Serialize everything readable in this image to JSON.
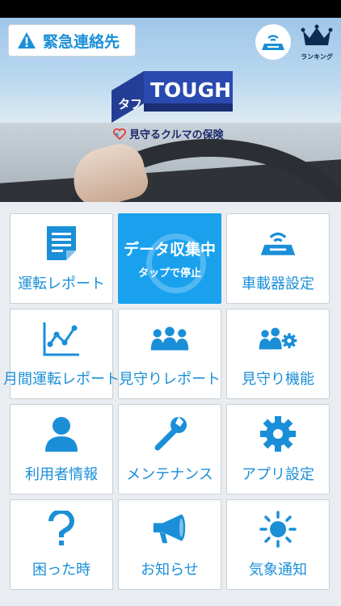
{
  "colors": {
    "accent": "#1a8fd8",
    "active_tile": "#1aa1ee",
    "navy": "#0f2b52"
  },
  "header": {
    "emergency_label": "緊急連絡先",
    "brand_kana": "タフ",
    "brand_name": "TOUGH",
    "tagline": "見守るクルマの保険",
    "ranking_label": "ランキング"
  },
  "menu": {
    "driving_report": "運転レポート",
    "collect_title": "データ収集中",
    "collect_sub": "タップで停止",
    "device_settings": "車載器設定",
    "monthly_report": "月間運転レポート",
    "watch_report": "見守りレポート",
    "watch_function": "見守り機能",
    "user_info": "利用者情報",
    "maintenance": "メンテナンス",
    "app_settings": "アプリ設定",
    "trouble": "困った時",
    "notice": "お知らせ",
    "weather": "気象通知"
  }
}
